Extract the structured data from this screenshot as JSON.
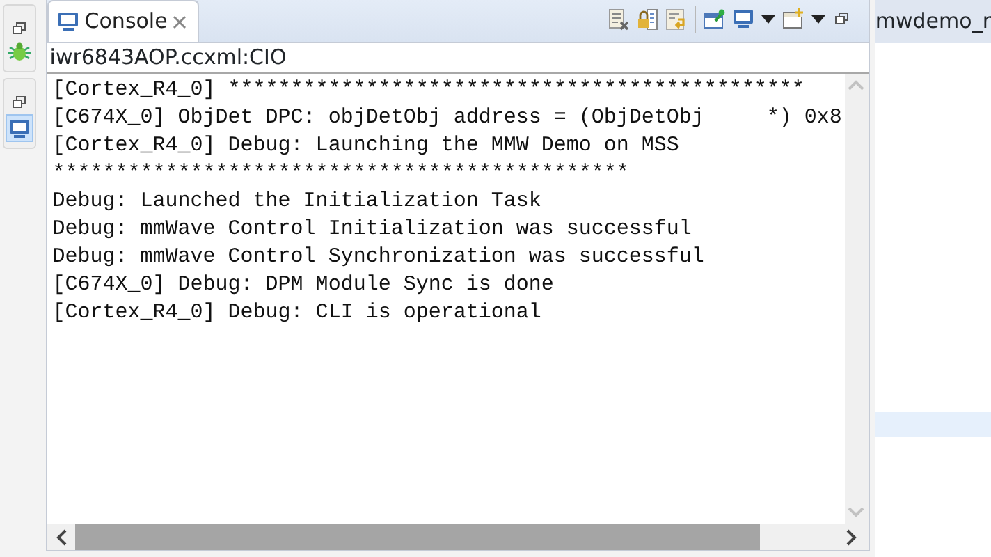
{
  "view_tab": {
    "title": "Console",
    "selected": true
  },
  "toolbar": [
    {
      "kind": "clear"
    },
    {
      "kind": "lock"
    },
    {
      "kind": "wrap"
    },
    {
      "kind": "sep"
    },
    {
      "kind": "pin"
    },
    {
      "kind": "display"
    },
    {
      "kind": "caret"
    },
    {
      "kind": "newconsole"
    },
    {
      "kind": "caret"
    },
    {
      "kind": "restore"
    }
  ],
  "console_name": "iwr6843AOP.ccxml:CIO",
  "lines": [
    "[Cortex_R4_0] **********************************************",
    "[C674X_0] ObjDet DPC: objDetObj address = (ObjDetObj     *) 0x8",
    "[Cortex_R4_0] Debug: Launching the MMW Demo on MSS",
    "**********************************************",
    "Debug: Launched the Initialization Task",
    "Debug: mmWave Control Initialization was successful",
    "Debug: mmWave Control Synchronization was successful",
    "[C674X_0] Debug: DPM Module Sync is done",
    "[Cortex_R4_0] Debug: CLI is operational"
  ],
  "side_panel": {
    "title": "mwdemo_r"
  }
}
